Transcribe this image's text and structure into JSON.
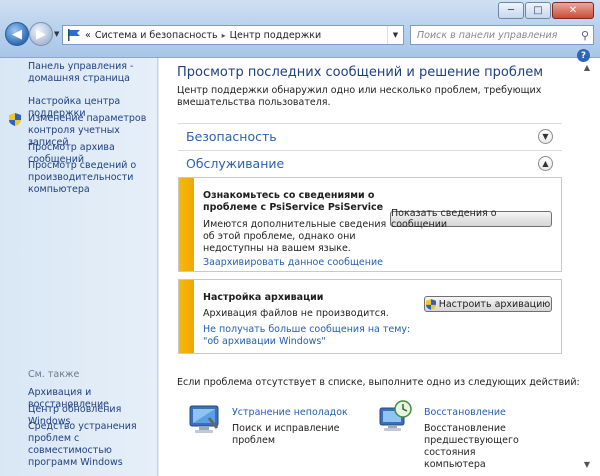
{
  "window": {
    "minimize_glyph": "─",
    "maximize_glyph": "□",
    "close_glyph": "✕"
  },
  "address": {
    "prefix": "«",
    "crumbs": [
      "Система и безопасность",
      "Центр поддержки"
    ],
    "separator": "▸"
  },
  "search": {
    "placeholder": "Поиск в панели управления"
  },
  "sidebar": {
    "home": "Панель управления - домашняя страница",
    "items": [
      "Настройка центра поддержки",
      "Изменение параметров контроля учетных записей",
      "Просмотр архива сообщений",
      "Просмотр сведений о производительности компьютера"
    ],
    "see_also_heading": "См. также",
    "see_also": [
      "Архивация и восстановление",
      "Центр обновления Windows",
      "Средство устранения проблем с совместимостью программ Windows"
    ]
  },
  "main": {
    "title": "Просмотр последних сообщений и решение проблем",
    "description": "Центр поддержки обнаружил одно или несколько проблем, требующих вмешательства пользователя.",
    "security_heading": "Безопасность",
    "maintenance_heading": "Обслуживание",
    "message1": {
      "title": "Ознакомьтесь со сведениями о проблеме с PsiService PsiService",
      "text": "Имеются дополнительные сведения об этой проблеме, однако они недоступны на вашем языке.",
      "link": "Заархивировать данное сообщение",
      "button": "Показать сведения о сообщении"
    },
    "message2": {
      "title": "Настройка архивации",
      "text": "Архивация файлов не производится.",
      "link": "Не получать больше сообщения на тему: \"об архивации Windows\"",
      "button": "Настроить архивацию"
    },
    "bottom_text": "Если проблема отсутствует в списке, выполните одно из следующих действий:",
    "actions": [
      {
        "link": "Устранение неполадок",
        "desc": "Поиск и исправление проблем"
      },
      {
        "link": "Восстановление",
        "desc": "Восстановление предшествующего состояния компьютера"
      }
    ]
  },
  "colors": {
    "accent": "#2a62b4",
    "warning_stripe": "#f8b70e",
    "link": "#1f5fb4"
  }
}
